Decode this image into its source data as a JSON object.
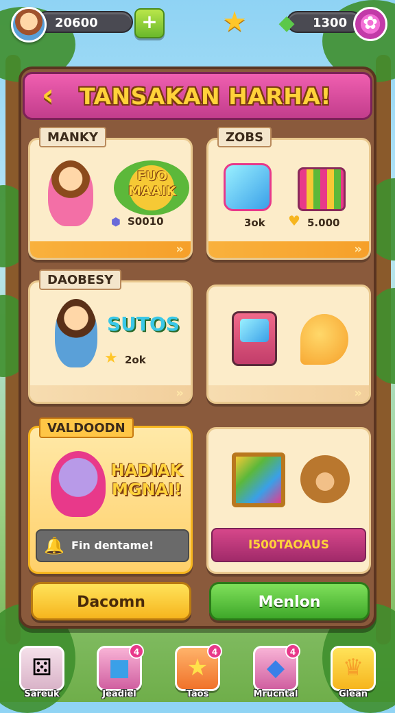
{
  "hud": {
    "coins": "20600",
    "gems": "1300",
    "icons": [
      "avatar",
      "plus-icon",
      "star-icon",
      "gem-icon",
      "settings-icon"
    ]
  },
  "panel": {
    "title": "TANSAKAN HARHA!",
    "cards": [
      {
        "tag": "MANKY",
        "headline": "FUO\nMAAIK",
        "stat": "S0010"
      },
      {
        "tag": "ZOBS",
        "stat_left": "3ok",
        "stat_right": "5.000"
      },
      {
        "tag": "DAOBESY",
        "headline": "SUTOS",
        "stat": "2ok"
      },
      {
        "tag": ""
      },
      {
        "tag": "VALDOODN",
        "headline": "HADIAK\nMGNAI!",
        "footer": "Fin dentame!"
      },
      {
        "tag": "",
        "footer": "I500TAOAUS"
      }
    ],
    "buttons": {
      "left": "Dacomn",
      "right": "Menlon"
    }
  },
  "nav": [
    {
      "label": "Sareuk",
      "badge": ""
    },
    {
      "label": "Jeadiel",
      "badge": "4"
    },
    {
      "label": "Taos",
      "badge": "4"
    },
    {
      "label": "Mrucntal",
      "badge": "4"
    },
    {
      "label": "Glean",
      "badge": ""
    }
  ],
  "colors": {
    "title_bar": "#c23d8c",
    "panel": "#8a5a3c",
    "accent_yellow": "#ffd23a",
    "green": "#3fa82a"
  }
}
